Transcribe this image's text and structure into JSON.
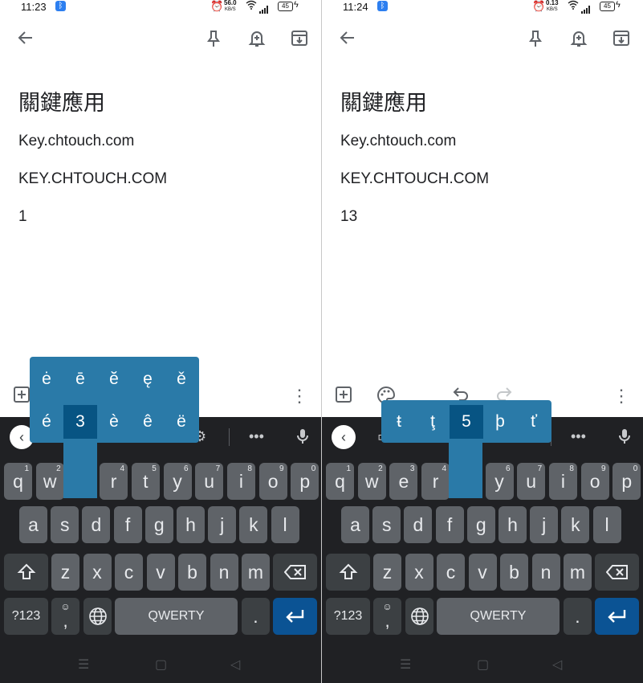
{
  "panels": [
    {
      "status": {
        "time": "11:23",
        "speed_value": "56.0",
        "speed_unit": "KB/S",
        "battery": "45"
      },
      "note": {
        "title": "關鍵應用",
        "lines": [
          "Key.chtouch.com",
          "KEY.CHTOUCH.COM",
          "1"
        ]
      },
      "popup": {
        "row1": [
          "ė",
          "ē",
          "ĕ",
          "ę",
          "ě"
        ],
        "row2": [
          "é",
          "3",
          "è",
          "ê",
          "ë"
        ],
        "selected": "3"
      }
    },
    {
      "status": {
        "time": "11:24",
        "speed_value": "0.13",
        "speed_unit": "KB/S",
        "battery": "45"
      },
      "note": {
        "title": "關鍵應用",
        "lines": [
          "Key.chtouch.com",
          "KEY.CHTOUCH.COM",
          "13"
        ]
      },
      "popup": {
        "row1": [
          "ŧ",
          "ţ",
          "5",
          "þ",
          "ť"
        ],
        "selected": "5"
      }
    }
  ],
  "keyboard": {
    "row1": [
      [
        "q",
        "1"
      ],
      [
        "w",
        "2"
      ],
      [
        "e",
        "3"
      ],
      [
        "r",
        "4"
      ],
      [
        "t",
        "5"
      ],
      [
        "y",
        "6"
      ],
      [
        "u",
        "7"
      ],
      [
        "i",
        "8"
      ],
      [
        "o",
        "9"
      ],
      [
        "p",
        "0"
      ]
    ],
    "row2": [
      "a",
      "s",
      "d",
      "f",
      "g",
      "h",
      "j",
      "k",
      "l"
    ],
    "row3": [
      "z",
      "x",
      "c",
      "v",
      "b",
      "n",
      "m"
    ],
    "symbols_label": "?123",
    "comma": ",",
    "space_label": "QWERTY",
    "period": "."
  },
  "colors": {
    "popup": "#2a7aa8",
    "popup_selected": "#075483",
    "enter": "#0b5394",
    "key": "#5f6368",
    "keyboard_bg": "#202124"
  },
  "icons": [
    "back-arrow-icon",
    "pin-icon",
    "reminder-bell-icon",
    "archive-icon",
    "add-box-icon",
    "palette-icon",
    "undo-icon",
    "redo-icon",
    "more-vert-icon",
    "mic-icon",
    "shift-icon",
    "backspace-icon",
    "globe-icon",
    "enter-icon"
  ]
}
